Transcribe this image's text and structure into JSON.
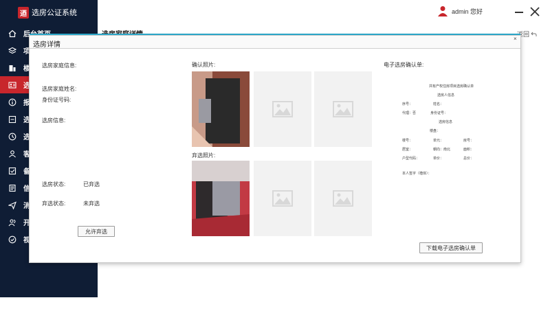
{
  "app": {
    "title": "选房公证系统",
    "logo_char": "迺"
  },
  "user": {
    "name": "admin 您好"
  },
  "nav": {
    "items": [
      {
        "label": "后台首页",
        "icon": "home-icon"
      },
      {
        "label": "项",
        "icon": "layers-icon"
      },
      {
        "label": "楼",
        "icon": "building-icon"
      },
      {
        "label": "选",
        "icon": "id-card-icon"
      },
      {
        "label": "报",
        "icon": "info-icon"
      },
      {
        "label": "选",
        "icon": "list-icon"
      },
      {
        "label": "选",
        "icon": "clock-icon"
      },
      {
        "label": "客",
        "icon": "user-icon"
      },
      {
        "label": "备",
        "icon": "checkbox-icon"
      },
      {
        "label": "信",
        "icon": "document-icon"
      },
      {
        "label": "消",
        "icon": "send-icon"
      },
      {
        "label": "开",
        "icon": "users-icon"
      },
      {
        "label": "视",
        "icon": "check-circle-icon"
      }
    ],
    "active_index": 3
  },
  "page": {
    "title": "选房家庭详情",
    "back_label": "返回"
  },
  "modal": {
    "title": "选房详情",
    "close_label": "×",
    "left": {
      "family_info_label": "选房家庭信息:",
      "family_name_label": "选房家庭姓名:",
      "id_number_label": "身份证号码:",
      "selection_info_label": "选房信息:",
      "status_label": "选房状态:",
      "status_value": "已弃选",
      "abandon_status_label": "弃选状态:",
      "abandon_status_value": "未弃选",
      "allow_abandon_button": "允许弃选"
    },
    "middle": {
      "confirm_photos_label": "确认照片:",
      "abandon_photos_label": "弃选照片:"
    },
    "right": {
      "e_confirm_label": "电子选房确认单:",
      "download_button": "下载电子选房确认单",
      "doc": {
        "title": "共有产权住房项目选房确认单",
        "section_person": "选房人信息",
        "seq": "序号：",
        "name": "姓名：",
        "proxy": "代理：否",
        "id_no": "身份证号：",
        "section_room": "选房信息",
        "building_name": "楼盘：",
        "building_no": "楼号：",
        "unit": "单元：",
        "room_no": "房号：",
        "layout": "居室：",
        "orientation": "朝向：南北",
        "area": "面积：",
        "type_code": "户型代码：",
        "unit_price": "单价：",
        "total_price": "总价：",
        "signature": "本人签字（楷体）："
      }
    }
  },
  "colors": {
    "sidebar": "#0f1d35",
    "active": "#c8262c",
    "accent": "#2aa6c8"
  }
}
